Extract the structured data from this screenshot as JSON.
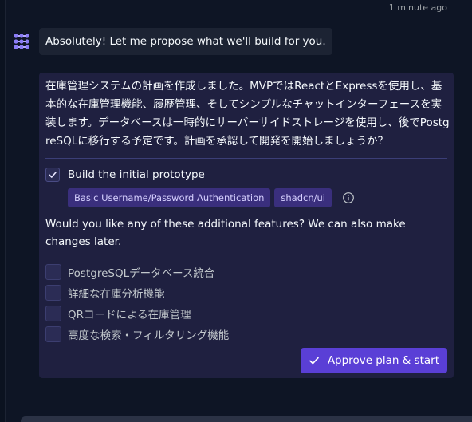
{
  "message": {
    "timestamp": "1 minute ago",
    "avatar_icon": "agent-logo-icon",
    "greeting": "Absolutely! Let me propose what we'll build for you."
  },
  "plan": {
    "description": "在庫管理システムの計画を作成しました。MVPではReactとExpressを使用し、基本的な在庫管理機能、履歴管理、そしてシンプルなチャットインターフェースを実装します。データベースは一時的にサーバーサイドストレージを使用し、後でPostgreSQLに移行する予定です。計画を承認して開発を開始しましょうか？",
    "prototype": {
      "label": "Build the initial prototype",
      "checked": true,
      "tags": [
        "Basic Username/Password Authentication",
        "shadcn/ui"
      ],
      "info_icon": "info-icon"
    },
    "question": "Would you like any of these additional features? We can also make changes later.",
    "features": [
      {
        "label": "PostgreSQLデータベース統合",
        "checked": false
      },
      {
        "label": "詳細な在庫分析機能",
        "checked": false
      },
      {
        "label": "QRコードによる在庫管理",
        "checked": false
      },
      {
        "label": "高度な検索・フィルタリング機能",
        "checked": false
      }
    ],
    "approve_label": "Approve plan & start"
  },
  "colors": {
    "background": "#0e1525",
    "card": "#1f2040",
    "tag": "#3a2f7d",
    "accent": "#5a3fd6",
    "text": "#f5f9fc",
    "muted": "#9da2a6"
  }
}
